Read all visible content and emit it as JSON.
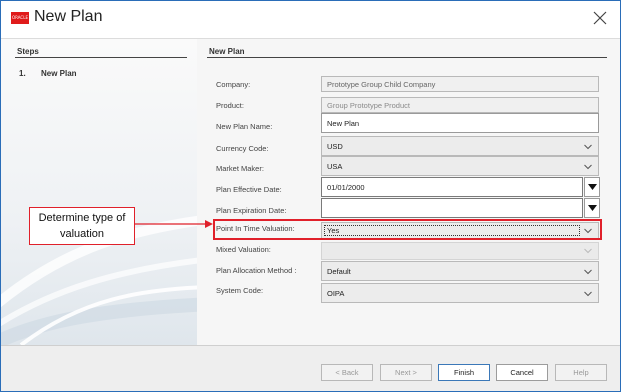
{
  "window": {
    "title": "New Plan",
    "logo_text": "ORACLE",
    "brand_color": "#e01b1b"
  },
  "steps": {
    "heading": "Steps",
    "items": [
      {
        "number": "1.",
        "label": "New Plan"
      }
    ]
  },
  "form": {
    "heading": "New Plan",
    "fields": {
      "company": {
        "label": "Company:",
        "value": "Prototype Group Child Company"
      },
      "product": {
        "label": "Product:",
        "value": "Group Prototype Product"
      },
      "plan_name": {
        "label": "New Plan Name:",
        "value": "New Plan"
      },
      "currency": {
        "label": "Currency Code:",
        "value": "USD"
      },
      "market_maker": {
        "label": "Market Maker:",
        "value": "USA"
      },
      "effective_date": {
        "label": "Plan Effective Date:",
        "value": "01/01/2000"
      },
      "expiration_date": {
        "label": "Plan Expiration Date:",
        "value": ""
      },
      "pit_valuation": {
        "label": "Point In Time Valuation:",
        "value": "Yes"
      },
      "mixed_valuation": {
        "label": "Mixed Valuation:",
        "value": ""
      },
      "allocation_method": {
        "label": "Plan Allocation Method :",
        "value": "Default"
      },
      "system_code": {
        "label": "System Code:",
        "value": "OIPA"
      }
    }
  },
  "annotation": {
    "callout_text": "Determine type of valuation",
    "color": "#e0202a"
  },
  "footer": {
    "back": "< Back",
    "next": "Next >",
    "finish": "Finish",
    "cancel": "Cancel",
    "help": "Help"
  }
}
